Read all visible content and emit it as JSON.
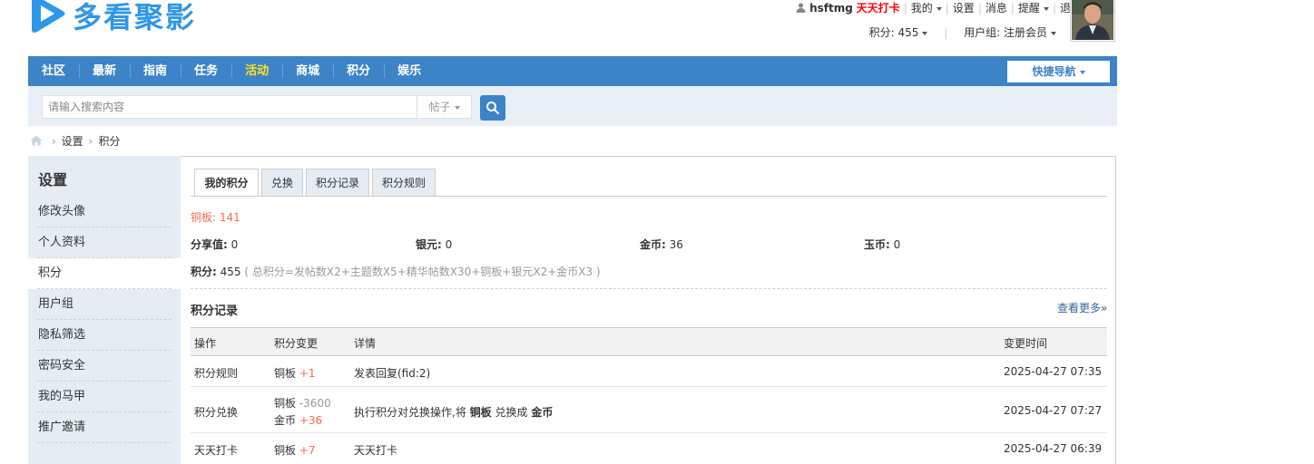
{
  "logo": {
    "text": "多看聚影"
  },
  "userbar": {
    "username": "hsftmg",
    "checkin": "天天打卡",
    "my": "我的",
    "settings": "设置",
    "messages": "消息",
    "reminders": "提醒",
    "logout": "退出",
    "points": "积分: 455",
    "usergroup": "用户组: 注册会员"
  },
  "nav": {
    "items": [
      "社区",
      "最新",
      "指南",
      "任务",
      "活动",
      "商城",
      "积分",
      "娱乐"
    ],
    "active_index": 4,
    "quick_nav": "快捷导航"
  },
  "search": {
    "placeholder": "请输入搜索内容",
    "type": "帖子"
  },
  "breadcrumb": [
    "设置",
    "积分"
  ],
  "sidebar": {
    "title": "设置",
    "items": [
      "修改头像",
      "个人资料",
      "积分",
      "用户组",
      "隐私筛选",
      "密码安全",
      "我的马甲",
      "推广邀请"
    ],
    "active_index": 2
  },
  "tabs": [
    "我的积分",
    "兑换",
    "积分记录",
    "积分规则"
  ],
  "credits": {
    "copper_label": "铜板:",
    "copper_value": "141",
    "share_label": "分享值:",
    "share_value": "0",
    "silver_label": "银元:",
    "silver_value": "0",
    "gold_label": "金币:",
    "gold_value": "36",
    "jade_label": "玉币:",
    "jade_value": "0",
    "total_label": "积分:",
    "total_value": "455",
    "formula": "( 总积分=发帖数X2+主题数X5+精华帖数X30+铜板+银元X2+金币X3 )"
  },
  "log": {
    "title": "积分记录",
    "more": "查看更多»",
    "headers": [
      "操作",
      "积分变更",
      "详情",
      "变更时间"
    ],
    "rows": [
      {
        "action": "积分规则",
        "changes": [
          {
            "name": "铜板",
            "delta": "+1"
          }
        ],
        "detail": "发表回复(fid:2)",
        "time": "2025-04-27 07:35"
      },
      {
        "action": "积分兑换",
        "changes": [
          {
            "name": "铜板",
            "delta": "-3600"
          },
          {
            "name": "金币",
            "delta": "+36"
          }
        ],
        "detail_prefix": "执行积分对兑换操作,将",
        "detail_from": "铜板",
        "detail_mid": "兑换成",
        "detail_to": "金币",
        "time": "2025-04-27 07:27"
      },
      {
        "action": "天天打卡",
        "changes": [
          {
            "name": "铜板",
            "delta": "+7"
          }
        ],
        "detail": "天天打卡",
        "time": "2025-04-27 06:39"
      }
    ]
  }
}
